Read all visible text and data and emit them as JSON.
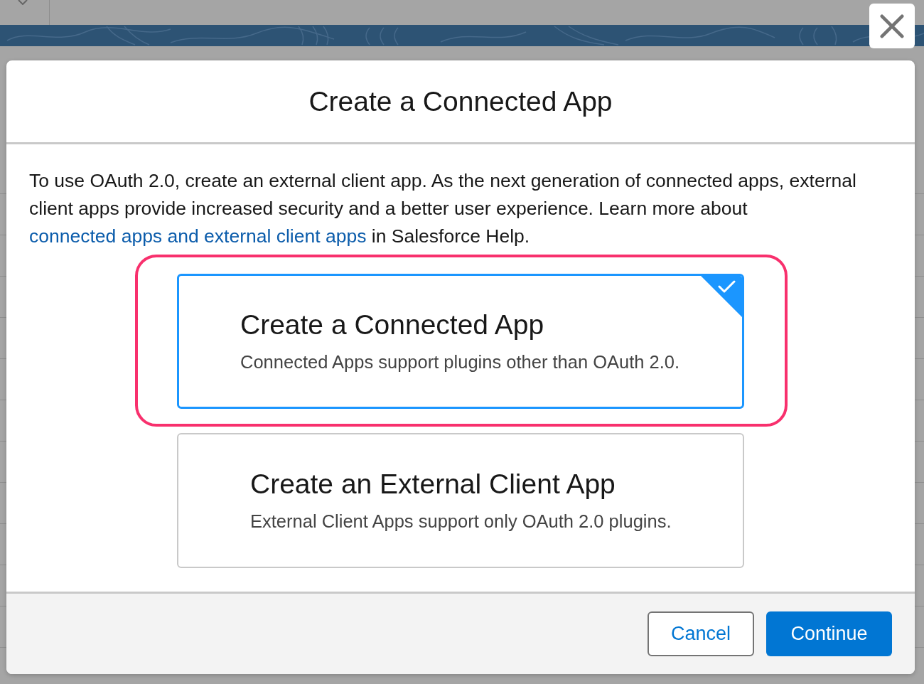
{
  "modal": {
    "title": "Create a Connected App",
    "intro": {
      "before": "To use OAuth 2.0, create an external client app. As the next generation of connected apps, external client apps provide increased security and a better user experience. Learn more about ",
      "link": "connected apps and external client apps",
      "after": " in Salesforce Help."
    },
    "options": [
      {
        "title": "Create a Connected App",
        "description": "Connected Apps support plugins other than OAuth 2.0.",
        "selected": true,
        "highlighted": true
      },
      {
        "title": "Create an External Client App",
        "description": "External Client Apps support only OAuth 2.0 plugins.",
        "selected": false,
        "highlighted": false
      }
    ],
    "buttons": [
      {
        "label": "Cancel",
        "kind": "neutral"
      },
      {
        "label": "Continue",
        "kind": "brand"
      }
    ]
  }
}
